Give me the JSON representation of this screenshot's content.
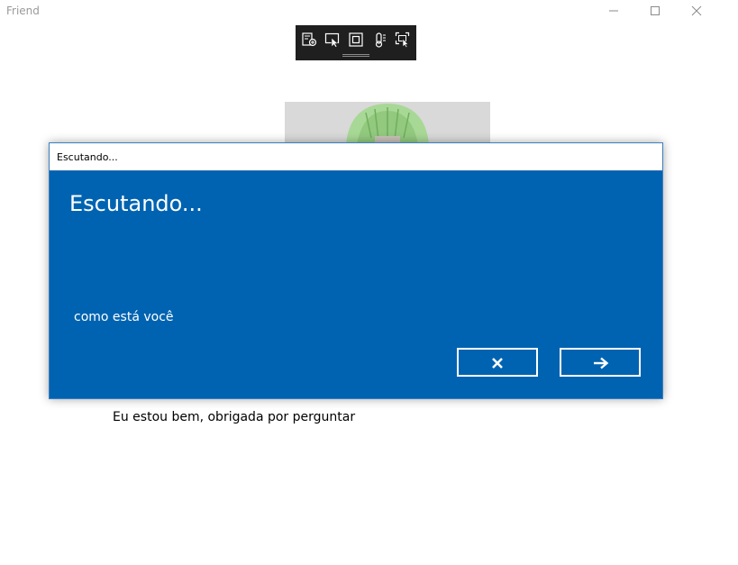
{
  "window": {
    "title": "Friend"
  },
  "devtools": {
    "tools": [
      "live-visual-tree-icon",
      "select-element-icon",
      "display-layout-adorners-icon",
      "track-focus-icon",
      "preview-selection-icon"
    ]
  },
  "dialog": {
    "titlebar": "Escutando...",
    "heading": "Escutando...",
    "recognized_text": "como está você",
    "cancel_icon": "close-icon",
    "ok_icon": "arrow-right-icon"
  },
  "response": {
    "text": "Eu estou bem, obrigada por perguntar"
  },
  "colors": {
    "dialog_bg": "#0063b1",
    "devbar_bg": "#1f1f1f",
    "avatar_hair": "#9ed08a"
  }
}
